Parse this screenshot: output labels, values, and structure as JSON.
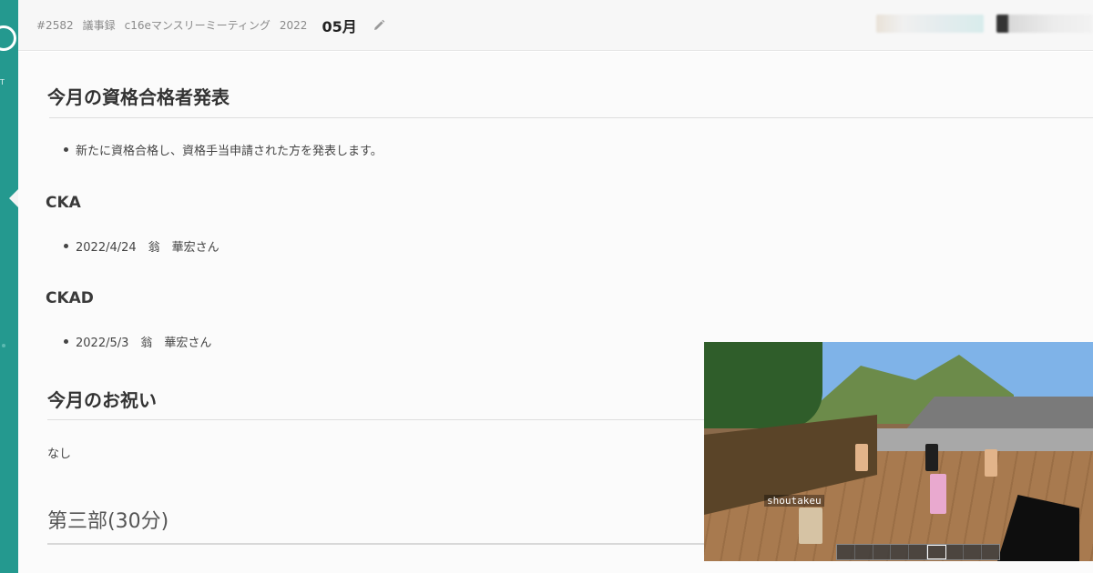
{
  "header": {
    "id": "#2582",
    "category": "議事録",
    "meeting": "c16eマンスリーミーティング",
    "year": "2022",
    "month": "05月"
  },
  "rail": {
    "label": "T"
  },
  "document": {
    "section1": {
      "title": "今月の資格合格者発表",
      "bullet": "新たに資格合格し、資格手当申請された方を発表します。"
    },
    "cka": {
      "title": "CKA",
      "item": "2022/4/24　翁　華宏さん"
    },
    "ckad": {
      "title": "CKAD",
      "item": "2022/5/3　翁　華宏さん"
    },
    "section2": {
      "title": "今月のお祝い",
      "body": "なし"
    },
    "section3": {
      "title": "第三部(30分)"
    }
  },
  "video": {
    "player_name": "shoutakeu"
  },
  "colors": {
    "rail": "#24998f",
    "header_bg": "#f7f7f7"
  },
  "icons": {
    "edit": "pencil-icon",
    "rail": "search-icon"
  }
}
